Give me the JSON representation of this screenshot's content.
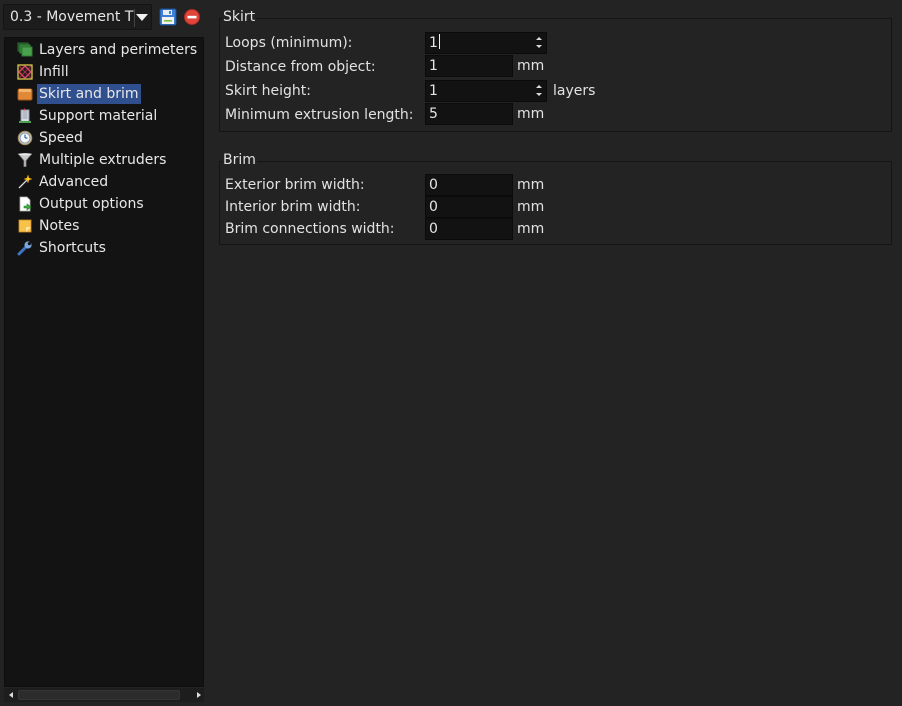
{
  "preset": {
    "selected": "0.3 - Movement T",
    "save_icon": "save-icon",
    "delete_icon": "delete-icon"
  },
  "sidebar": {
    "items": [
      {
        "label": "Layers and perimeters",
        "icon": "layers-icon",
        "selected": false
      },
      {
        "label": "Infill",
        "icon": "infill-icon",
        "selected": false
      },
      {
        "label": "Skirt and brim",
        "icon": "box-icon",
        "selected": true
      },
      {
        "label": "Support material",
        "icon": "building-icon",
        "selected": false
      },
      {
        "label": "Speed",
        "icon": "clock-icon",
        "selected": false
      },
      {
        "label": "Multiple extruders",
        "icon": "funnel-icon",
        "selected": false
      },
      {
        "label": "Advanced",
        "icon": "wand-icon",
        "selected": false
      },
      {
        "label": "Output options",
        "icon": "page-export-icon",
        "selected": false
      },
      {
        "label": "Notes",
        "icon": "note-icon",
        "selected": false
      },
      {
        "label": "Shortcuts",
        "icon": "wrench-icon",
        "selected": false
      }
    ]
  },
  "skirt": {
    "title": "Skirt",
    "loops": {
      "label": "Loops (minimum):",
      "value": "1"
    },
    "distance": {
      "label": "Distance from object:",
      "value": "1",
      "unit": "mm"
    },
    "height": {
      "label": "Skirt height:",
      "value": "1",
      "unit": "layers"
    },
    "min_extrusion": {
      "label": "Minimum extrusion length:",
      "value": "5",
      "unit": "mm"
    }
  },
  "brim": {
    "title": "Brim",
    "exterior": {
      "label": "Exterior brim width:",
      "value": "0",
      "unit": "mm"
    },
    "interior": {
      "label": "Interior brim width:",
      "value": "0",
      "unit": "mm"
    },
    "connections": {
      "label": "Brim connections width:",
      "value": "0",
      "unit": "mm"
    }
  },
  "colors": {
    "selection": "#2f4f8f",
    "background": "#232323",
    "tree_background": "#131313"
  }
}
